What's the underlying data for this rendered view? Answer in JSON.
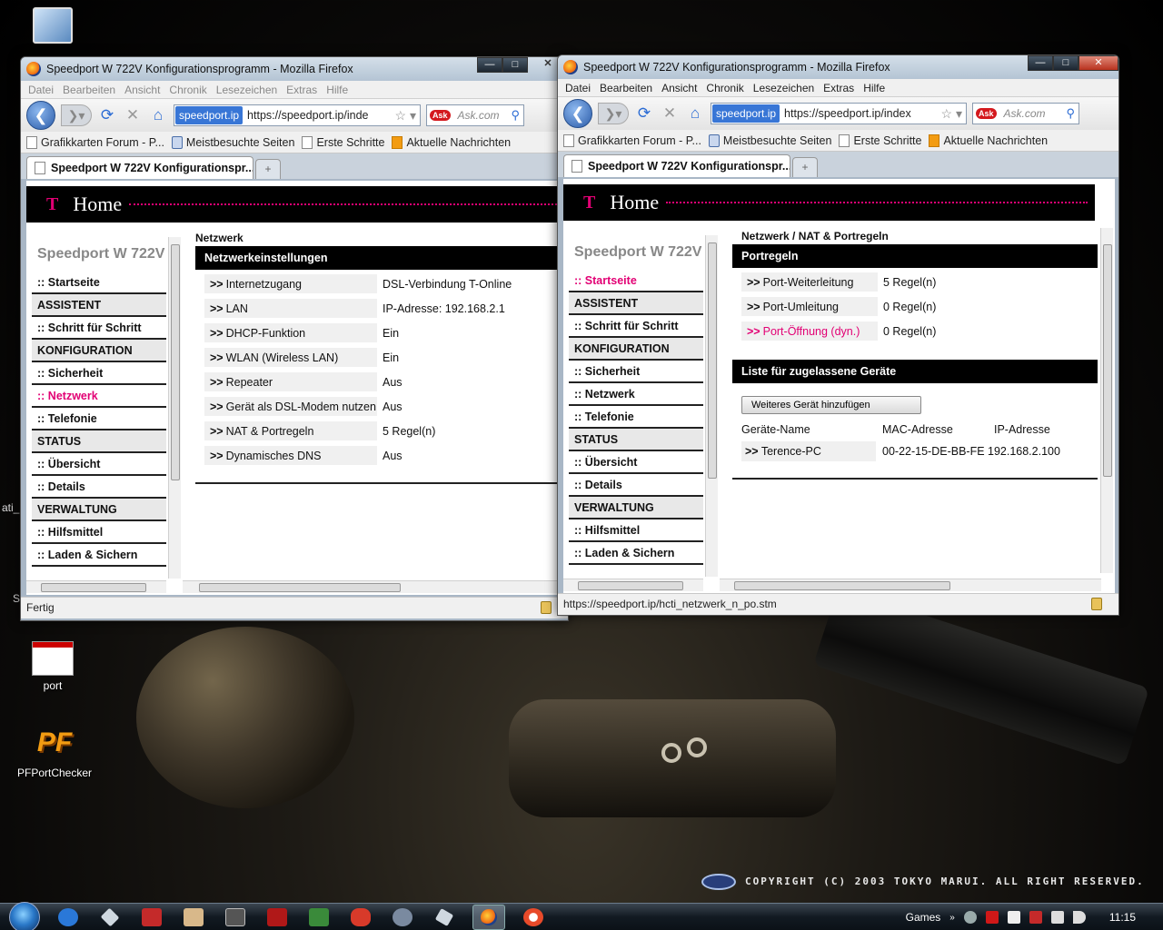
{
  "desktop": {
    "icons": [
      {
        "label": ""
      },
      {
        "label": "port"
      },
      {
        "label": "PFPortChecker"
      }
    ],
    "fragments": [
      "ati_",
      "S"
    ],
    "copyright": "COPYRIGHT (C) 2003 TOKYO MARUI. ALL RIGHT RESERVED."
  },
  "browser": {
    "title": "Speedport W 722V Konfigurationsprogramm - Mozilla Firefox",
    "menu": [
      "Datei",
      "Bearbeiten",
      "Ansicht",
      "Chronik",
      "Lesezeichen",
      "Extras",
      "Hilfe"
    ],
    "site_identity": "speedport.ip",
    "search_placeholder": "Ask.com",
    "bookmarks": [
      "Grafikkarten Forum - P...",
      "Meistbesuchte Seiten",
      "Erste Schritte",
      "Aktuelle Nachrichten"
    ],
    "tab_label": "Speedport W 722V Konfigurationspr...",
    "header_home": "Home",
    "header_logo": "T",
    "brand": "Speedport W 722V",
    "nav": [
      {
        "label": ":: Startseite",
        "type": "item"
      },
      {
        "label": "ASSISTENT",
        "type": "section"
      },
      {
        "label": ":: Schritt für Schritt",
        "type": "item"
      },
      {
        "label": "KONFIGURATION",
        "type": "section"
      },
      {
        "label": ":: Sicherheit",
        "type": "item"
      },
      {
        "label": ":: Netzwerk",
        "type": "item"
      },
      {
        "label": ":: Telefonie",
        "type": "item"
      },
      {
        "label": "STATUS",
        "type": "section"
      },
      {
        "label": ":: Übersicht",
        "type": "item"
      },
      {
        "label": ":: Details",
        "type": "item"
      },
      {
        "label": "VERWALTUNG",
        "type": "section"
      },
      {
        "label": ":: Hilfsmittel",
        "type": "item"
      },
      {
        "label": ":: Laden & Sichern",
        "type": "item"
      }
    ]
  },
  "window1": {
    "url": "https://speedport.ip/inde",
    "active_nav": ":: Netzwerk",
    "breadcrumb": "Netzwerk",
    "section_title": "Netzwerkeinstellungen",
    "rows": [
      {
        "arrow": ">>",
        "label": "Internetzugang",
        "value": "DSL-Verbindung T-Online"
      },
      {
        "arrow": ">>",
        "label": "LAN",
        "value": "IP-Adresse: 192.168.2.1"
      },
      {
        "arrow": ">>",
        "label": "DHCP-Funktion",
        "value": "Ein"
      },
      {
        "arrow": ">>",
        "label": "WLAN (Wireless LAN)",
        "value": "Ein"
      },
      {
        "arrow": ">>",
        "label": "Repeater",
        "value": "Aus"
      },
      {
        "arrow": ">>",
        "label": "Gerät als DSL-Modem nutzen",
        "value": "Aus"
      },
      {
        "arrow": ">>",
        "label": "NAT & Portregeln",
        "value": "5 Regel(n)"
      },
      {
        "arrow": ">>",
        "label": "Dynamisches DNS",
        "value": "Aus"
      }
    ],
    "status": "Fertig"
  },
  "window2": {
    "url": "https://speedport.ip/index",
    "active_nav": ":: Startseite",
    "breadcrumb": "Netzwerk / NAT & Portregeln",
    "section_title": "Portregeln",
    "rows": [
      {
        "arrow": ">>",
        "label": "Port-Weiterleitung",
        "value": "5 Regel(n)",
        "highlight": false
      },
      {
        "arrow": ">>",
        "label": "Port-Umleitung",
        "value": "0 Regel(n)",
        "highlight": false
      },
      {
        "arrow": ">>",
        "label": "Port-Öffnung (dyn.)",
        "value": "0 Regel(n)",
        "highlight": true
      }
    ],
    "devices_title": "Liste für zugelassene Geräte",
    "add_device_button": "Weiteres Gerät hinzufügen",
    "device_columns": [
      "Geräte-Name",
      "MAC-Adresse",
      "IP-Adresse"
    ],
    "devices": [
      {
        "arrow": ">>",
        "name": "Terence-PC",
        "mac": "00-22-15-DE-BB-FE",
        "ip": "192.168.2.100"
      }
    ],
    "status": "https://speedport.ip/hcti_netzwerk_n_po.stm"
  },
  "taskbar": {
    "tray_label": "Games",
    "clock": "11:15"
  },
  "colors": {
    "telekom_magenta": "#e20074",
    "header_black": "#000000"
  }
}
